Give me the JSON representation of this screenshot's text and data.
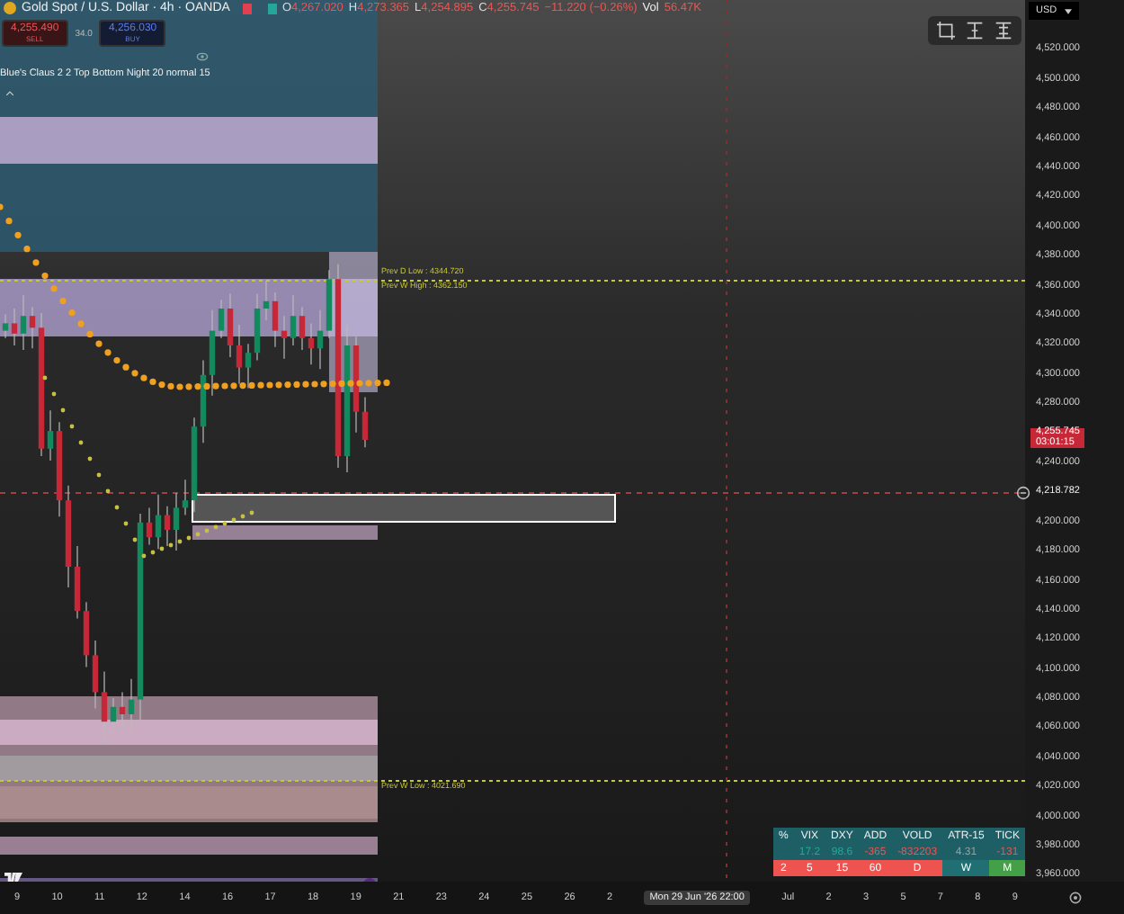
{
  "legend": {
    "symbol": "Gold Spot / U.S. Dollar · 4h · OANDA",
    "ohlc": [
      {
        "label": "O",
        "value": "4,267.020"
      },
      {
        "label": "H",
        "value": "4,273.365"
      },
      {
        "label": "L",
        "value": "4,254.895"
      },
      {
        "label": "C",
        "value": "4,255.745"
      }
    ],
    "change": "−11.220 (−0.26%)",
    "volume_label": "Vol",
    "volume": "56.47K"
  },
  "trade": {
    "sell_price": "4,255.490",
    "sell_label": "SELL",
    "spread": "34.0",
    "buy_price": "4,256.030",
    "buy_label": "BUY"
  },
  "indicator": {
    "title": "Blue's Claus 2 2 Top Bottom Night 20 normal 15"
  },
  "zone_labels": [
    {
      "text": "Prev D Low : 4344.720"
    },
    {
      "text": "Prev W High : 4362.150"
    },
    {
      "text": "Prev W Low : 4021.690"
    }
  ],
  "currency": "USD",
  "price_axis": [
    {
      "text": "4,520.000",
      "kind": "tick"
    },
    {
      "text": "4,500.000",
      "kind": "tick"
    },
    {
      "text": "4,480.000",
      "kind": "tick"
    },
    {
      "text": "4,460.000",
      "kind": "tick"
    },
    {
      "text": "4,440.000",
      "kind": "tick"
    },
    {
      "text": "4,420.000",
      "kind": "tick"
    },
    {
      "text": "4,400.000",
      "kind": "tick"
    },
    {
      "text": "4,380.000",
      "kind": "tick"
    },
    {
      "text": "4,360.000",
      "kind": "tick"
    },
    {
      "text": "4,340.000",
      "kind": "tick"
    },
    {
      "text": "4,320.000",
      "kind": "tick"
    },
    {
      "text": "4,300.000",
      "kind": "tick"
    },
    {
      "text": "4,280.000",
      "kind": "tick"
    },
    {
      "text": "4,255.745",
      "countdown": "03:01:15",
      "kind": "current"
    },
    {
      "text": "4,240.000",
      "kind": "tick"
    },
    {
      "text": "4,218.782",
      "kind": "crosshair"
    },
    {
      "text": "4,200.000",
      "kind": "tick"
    },
    {
      "text": "4,180.000",
      "kind": "tick"
    },
    {
      "text": "4,160.000",
      "kind": "tick"
    },
    {
      "text": "4,140.000",
      "kind": "tick"
    },
    {
      "text": "4,120.000",
      "kind": "tick"
    },
    {
      "text": "4,100.000",
      "kind": "tick"
    },
    {
      "text": "4,080.000",
      "kind": "tick"
    },
    {
      "text": "4,060.000",
      "kind": "tick"
    },
    {
      "text": "4,040.000",
      "kind": "tick"
    },
    {
      "text": "4,020.000",
      "kind": "tick"
    },
    {
      "text": "4,000.000",
      "kind": "tick"
    },
    {
      "text": "3,980.000",
      "kind": "tick"
    },
    {
      "text": "3,960.000",
      "kind": "tick"
    }
  ],
  "time_axis": [
    {
      "text": "9",
      "kind": "tick"
    },
    {
      "text": "10",
      "kind": "tick"
    },
    {
      "text": "11",
      "kind": "tick"
    },
    {
      "text": "12",
      "kind": "tick"
    },
    {
      "text": "14",
      "kind": "tick"
    },
    {
      "text": "16",
      "kind": "tick"
    },
    {
      "text": "17",
      "kind": "tick"
    },
    {
      "text": "18",
      "kind": "tick"
    },
    {
      "text": "19",
      "kind": "tick"
    },
    {
      "text": "21",
      "kind": "tick"
    },
    {
      "text": "23",
      "kind": "tick"
    },
    {
      "text": "24",
      "kind": "tick"
    },
    {
      "text": "25",
      "kind": "tick"
    },
    {
      "text": "26",
      "kind": "tick"
    },
    {
      "text": "2",
      "kind": "tick"
    },
    {
      "text": "Mon 29 Jun '26   22:00",
      "kind": "crosshair"
    },
    {
      "text": "Jul",
      "kind": "tick"
    },
    {
      "text": "2",
      "kind": "tick"
    },
    {
      "text": "3",
      "kind": "tick"
    },
    {
      "text": "5",
      "kind": "tick"
    },
    {
      "text": "7",
      "kind": "tick"
    },
    {
      "text": "8",
      "kind": "tick"
    },
    {
      "text": "9",
      "kind": "tick"
    }
  ],
  "market_table": {
    "columns": [
      "%",
      "VIX",
      "DXY",
      "ADD",
      "VOLD",
      "ATR-15",
      "TICK"
    ],
    "values": [
      {
        "text": "17.2",
        "color": "#26a69a"
      },
      {
        "text": "98.6",
        "color": "#26a69a"
      },
      {
        "text": "-365",
        "color": "#ef5350"
      },
      {
        "text": "-832203",
        "color": "#ef5350"
      },
      {
        "text": "4.31",
        "color": "#9e9e9e"
      },
      {
        "text": "-131",
        "color": "#ef5350"
      }
    ],
    "trend": [
      {
        "text": "2",
        "color": "#ef5350"
      },
      {
        "text": "5",
        "color": "#ef5350"
      },
      {
        "text": "15",
        "color": "#ef5350"
      },
      {
        "text": "60",
        "color": "#ef5350"
      },
      {
        "text": "D",
        "color": "#ef5350"
      },
      {
        "text": "W",
        "color": "#1f6f73"
      },
      {
        "text": "M",
        "color": "#43a047"
      }
    ]
  }
}
